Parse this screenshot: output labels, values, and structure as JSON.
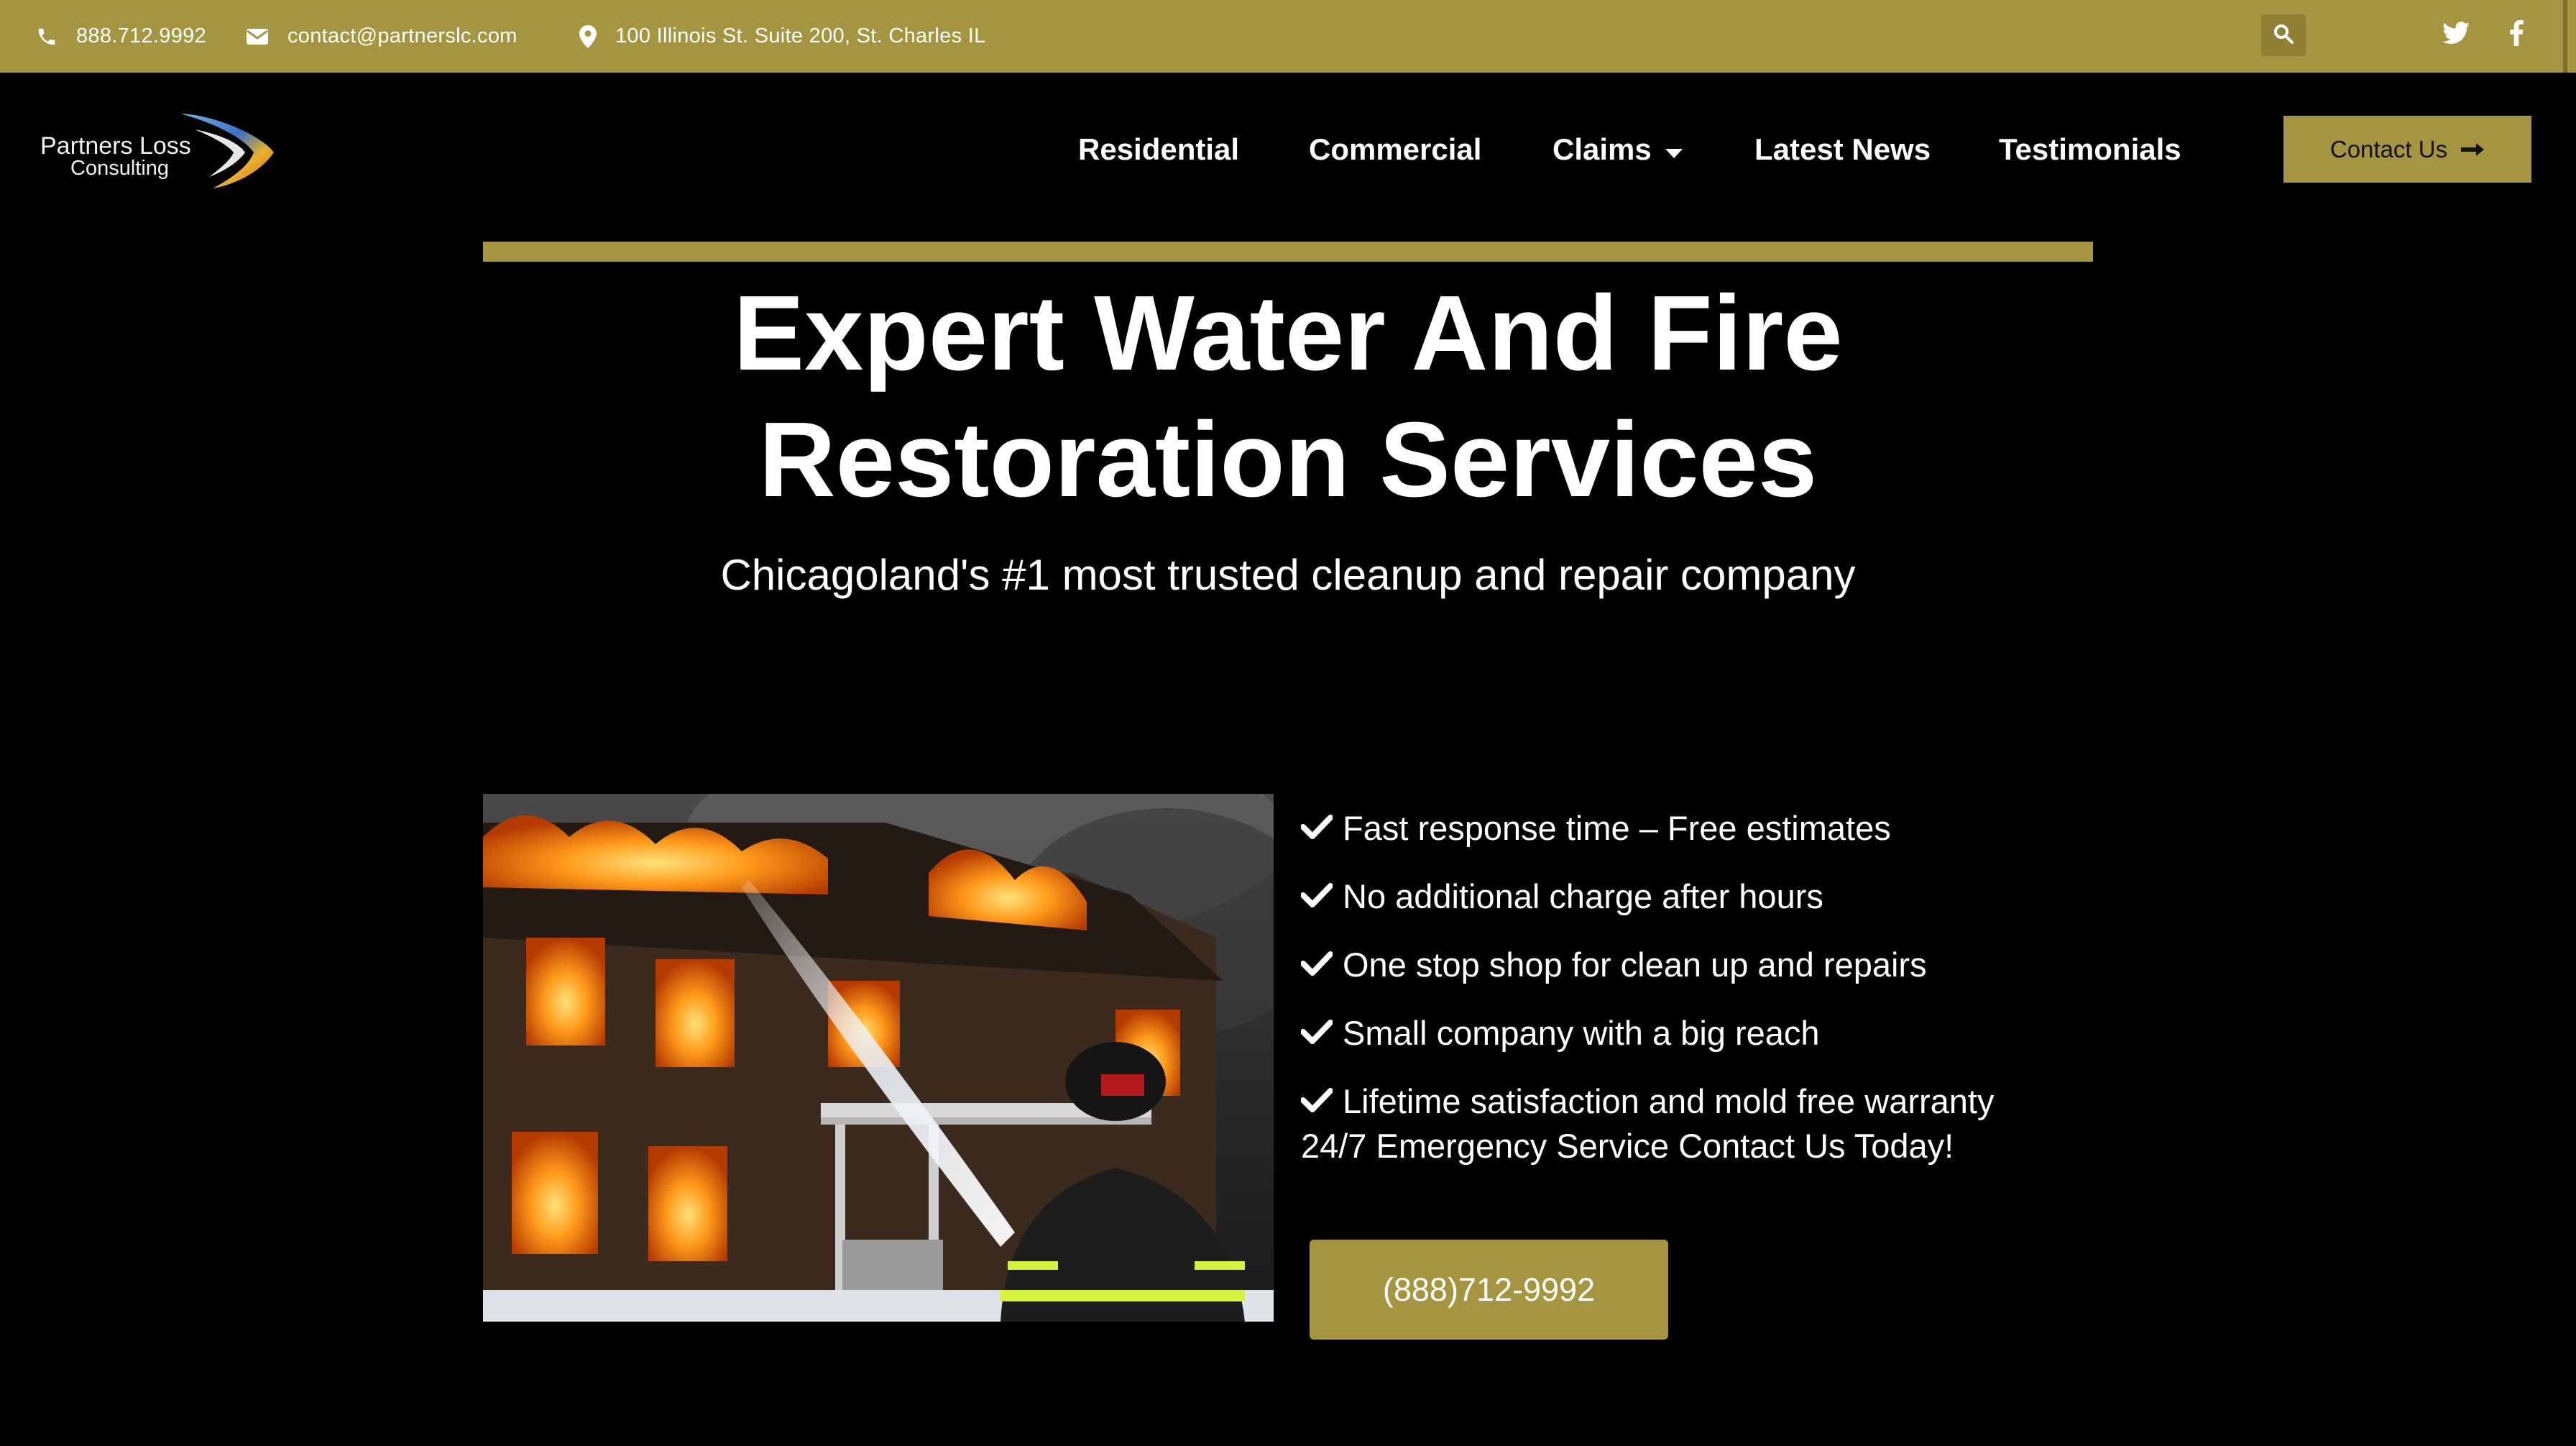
{
  "topbar": {
    "phone": "888.712.9992",
    "email": "contact@partnerslc.com",
    "address": "100 Illinois St. Suite 200, St. Charles IL",
    "icons": {
      "phone": "phone-icon",
      "email": "envelope-icon",
      "address": "map-pin-icon",
      "search": "search-icon",
      "twitter": "twitter-icon",
      "facebook": "facebook-icon"
    }
  },
  "logo": {
    "line1": "Partners Loss",
    "line2": "Consulting"
  },
  "nav": {
    "residential": "Residential",
    "commercial": "Commercial",
    "claims": "Claims",
    "news": "Latest News",
    "testimonials": "Testimonials"
  },
  "contact_button": {
    "label": "Contact Us",
    "icon": "arrow-right-icon"
  },
  "hero": {
    "title_line1": "Expert Water And Fire",
    "title_line2": "Restoration Services",
    "subtitle": "Chicagoland's #1 most trusted cleanup and repair company"
  },
  "features": [
    "Fast response time – Free estimates",
    "No additional charge after hours",
    "One stop shop for clean up and repairs",
    "Small company with a big reach",
    "Lifetime satisfaction and mold free warranty"
  ],
  "emergency_text": "24/7 Emergency Service Contact Us Today!",
  "phone_button": "(888)712-9992",
  "colors": {
    "accent_gold": "#a59540",
    "background": "#000000",
    "text": "#ffffff"
  }
}
